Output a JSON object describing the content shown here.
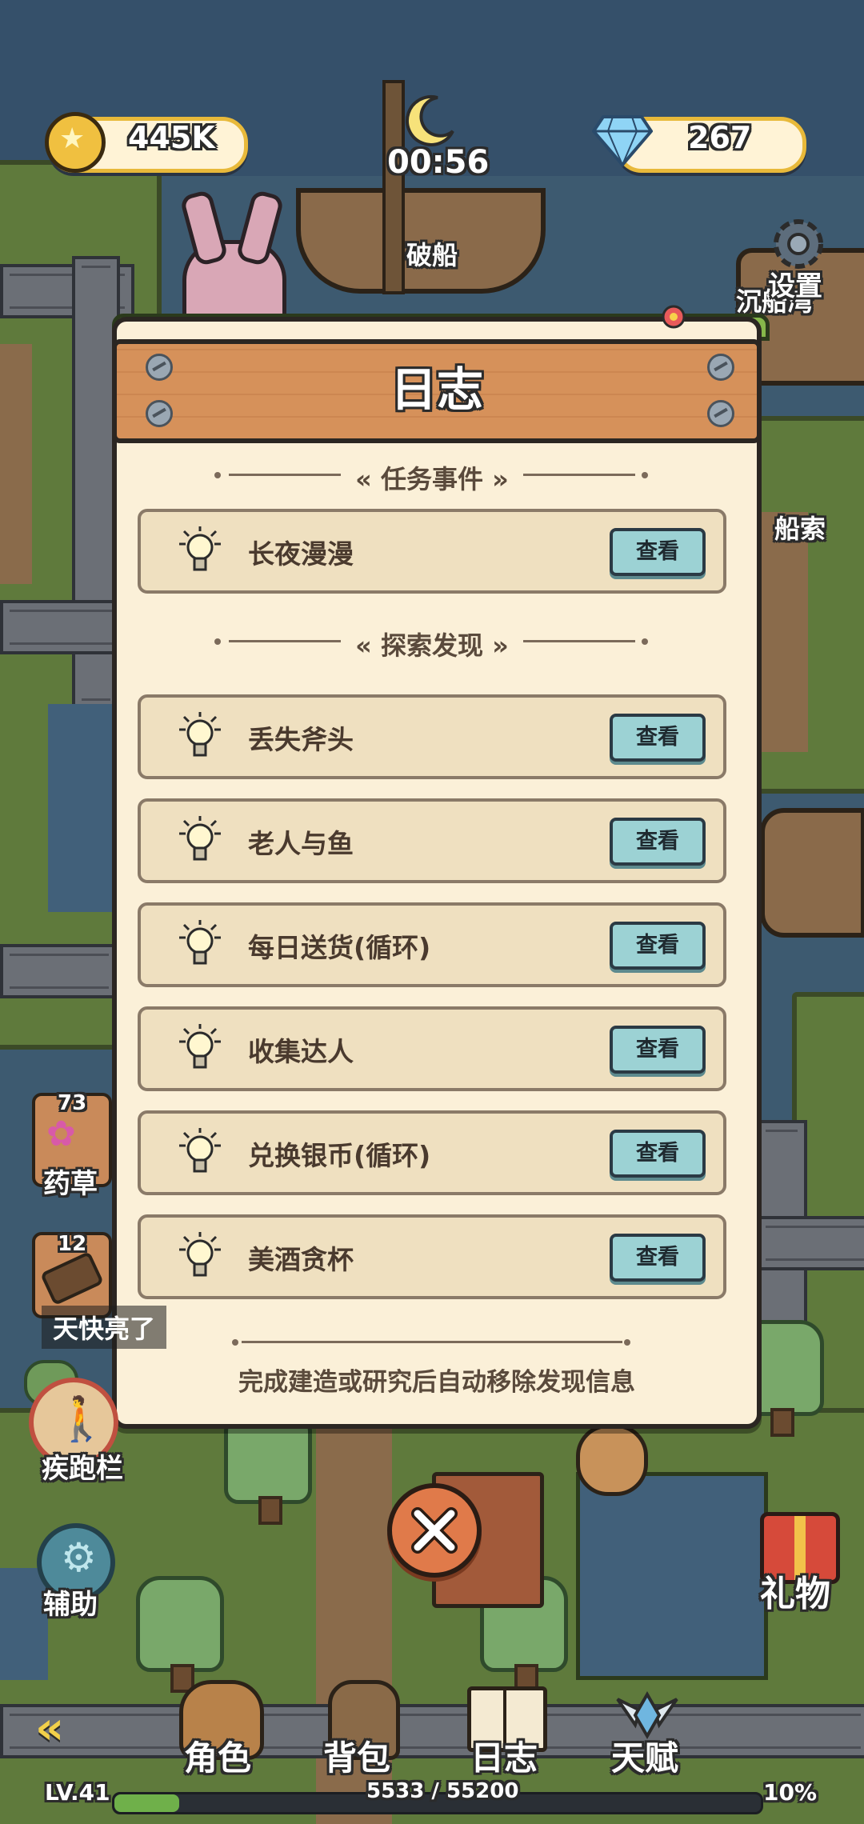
{
  "hud": {
    "gold": "445K",
    "gems": "267",
    "timer": "00:56",
    "location_label": "破船",
    "right_location_label": "沉船湾",
    "rope_label": "船索",
    "settings_label": "设置"
  },
  "journal": {
    "title": "日志",
    "section_missions": "任务事件",
    "section_discoveries": "探索发现",
    "missions": [
      {
        "label": "长夜漫漫",
        "button": "查看"
      }
    ],
    "discoveries": [
      {
        "label": "丢失斧头",
        "button": "查看"
      },
      {
        "label": "老人与鱼",
        "button": "查看"
      },
      {
        "label": "每日送货(循环)",
        "button": "查看"
      },
      {
        "label": "收集达人",
        "button": "查看"
      },
      {
        "label": "兑换银币(循环)",
        "button": "查看"
      },
      {
        "label": "美酒贪杯",
        "button": "查看"
      }
    ],
    "footer": "完成建造或研究后自动移除发现信息"
  },
  "left_panel": {
    "herb_count": "73",
    "herb_label": "药草",
    "wood_count": "12",
    "notice": "天快亮了",
    "sprint_label": "疾跑栏",
    "assist_label": "辅助"
  },
  "right_panel": {
    "gift_label": "礼物"
  },
  "bottom_nav": {
    "back_icon": "«",
    "character": "角色",
    "bag": "背包",
    "journal": "日志",
    "talent": "天赋"
  },
  "status": {
    "level": "LV.41",
    "xp": "5533 / 55200",
    "xp_progress": 0.1,
    "percent": "10%"
  },
  "colors": {
    "panel_bg": "#fbf0d8",
    "header": "#d6915a",
    "button": "#9cd2d4",
    "pill_border": "#e8b93a"
  }
}
